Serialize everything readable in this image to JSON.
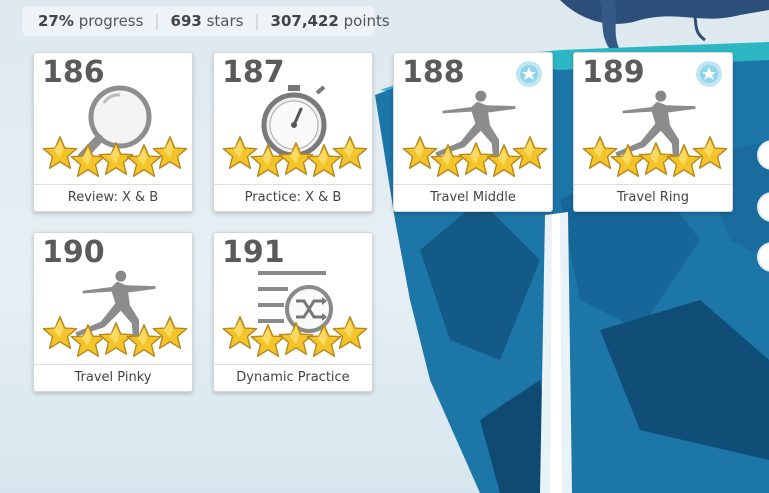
{
  "stats": {
    "progress_value": "27%",
    "progress_label": "progress",
    "stars_value": "693",
    "stars_label": "stars",
    "points_value": "307,422",
    "points_label": "points"
  },
  "lessons": [
    {
      "number": "186",
      "title": "Review: X & B",
      "icon": "magnifier-icon",
      "stars": 5,
      "badge": false
    },
    {
      "number": "187",
      "title": "Practice: X & B",
      "icon": "stopwatch-icon",
      "stars": 5,
      "badge": false
    },
    {
      "number": "188",
      "title": "Travel Middle",
      "icon": "pose-figure-icon",
      "stars": 5,
      "badge": true
    },
    {
      "number": "189",
      "title": "Travel Ring",
      "icon": "pose-figure-icon",
      "stars": 5,
      "badge": true
    },
    {
      "number": "190",
      "title": "Travel Pinky",
      "icon": "pose-figure-icon",
      "stars": 5,
      "badge": false
    },
    {
      "number": "191",
      "title": "Dynamic Practice",
      "icon": "shuffle-list-icon",
      "stars": 5,
      "badge": false
    }
  ],
  "colors": {
    "star": "#f4c52b",
    "number": "#5b5b5b",
    "badge": "#7fd0e8",
    "island": "#1f7fae"
  }
}
